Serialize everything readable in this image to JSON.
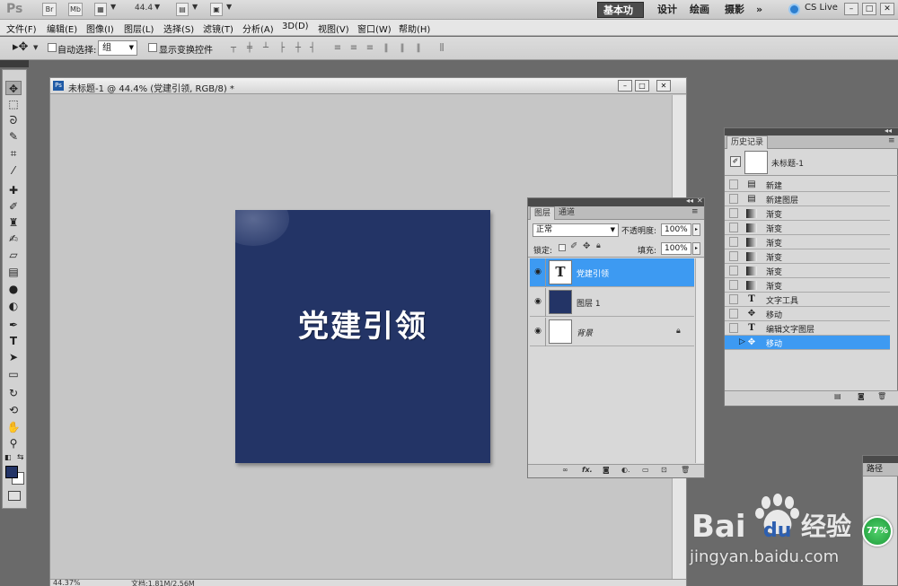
{
  "app": {
    "logo": "Ps",
    "bridge_label": "Br",
    "minibridge_label": "Mb",
    "zoom_value": "44.4",
    "workspaces": [
      "基本功能",
      "设计",
      "绘画",
      "摄影",
      "»"
    ],
    "cs_live": "CS Live",
    "window_controls": [
      "–",
      "□",
      "✕"
    ]
  },
  "menu": [
    "文件(F)",
    "编辑(E)",
    "图像(I)",
    "图层(L)",
    "选择(S)",
    "滤镜(T)",
    "分析(A)",
    "3D(D)",
    "视图(V)",
    "窗口(W)",
    "帮助(H)"
  ],
  "options": {
    "auto_select_label": "自动选择:",
    "auto_select_value": "组",
    "show_transform_label": "显示变换控件"
  },
  "document": {
    "title": "未标题-1 @ 44.4% (党建引领, RGB/8) *",
    "canvas_text": "党建引领",
    "status_zoom": "44.37%",
    "status_file": "文档:1.81M/2.56M"
  },
  "colors": {
    "foreground": "#233466",
    "background": "#ffffff",
    "selection": "#3d9af2"
  },
  "layers_panel": {
    "tabs": [
      "图层",
      "通道"
    ],
    "blend_mode": "正常",
    "opacity_label": "不透明度:",
    "opacity_value": "100%",
    "lock_label": "锁定:",
    "fill_label": "填充:",
    "fill_value": "100%",
    "layers": [
      {
        "name": "党建引领",
        "thumb": "T",
        "selected": true
      },
      {
        "name": "图层 1",
        "thumb": "",
        "selected": false
      },
      {
        "name": "背景",
        "thumb": "",
        "selected": false,
        "locked": true
      }
    ]
  },
  "history_panel": {
    "tab": "历史记录",
    "snapshot_name": "未标题-1",
    "items": [
      {
        "name": "新建",
        "icon": "doc-icon"
      },
      {
        "name": "新建图层",
        "icon": "doc-icon"
      },
      {
        "name": "渐变",
        "icon": "gradient-icon"
      },
      {
        "name": "渐变",
        "icon": "gradient-icon"
      },
      {
        "name": "渐变",
        "icon": "gradient-icon"
      },
      {
        "name": "渐变",
        "icon": "gradient-icon"
      },
      {
        "name": "渐变",
        "icon": "gradient-icon"
      },
      {
        "name": "渐变",
        "icon": "gradient-icon"
      },
      {
        "name": "文字工具",
        "icon": "type-icon"
      },
      {
        "name": "移动",
        "icon": "move-icon"
      },
      {
        "name": "编辑文字图层",
        "icon": "type-icon"
      },
      {
        "name": "移动",
        "icon": "move-icon",
        "selected": true
      }
    ]
  },
  "paths_panel": {
    "tab": "路径"
  },
  "badge": {
    "percent": "77%"
  },
  "watermark": {
    "url": "jingyan.baidu.com",
    "brand": "Bai",
    "brand_tail": "du",
    "cn": "经验"
  }
}
